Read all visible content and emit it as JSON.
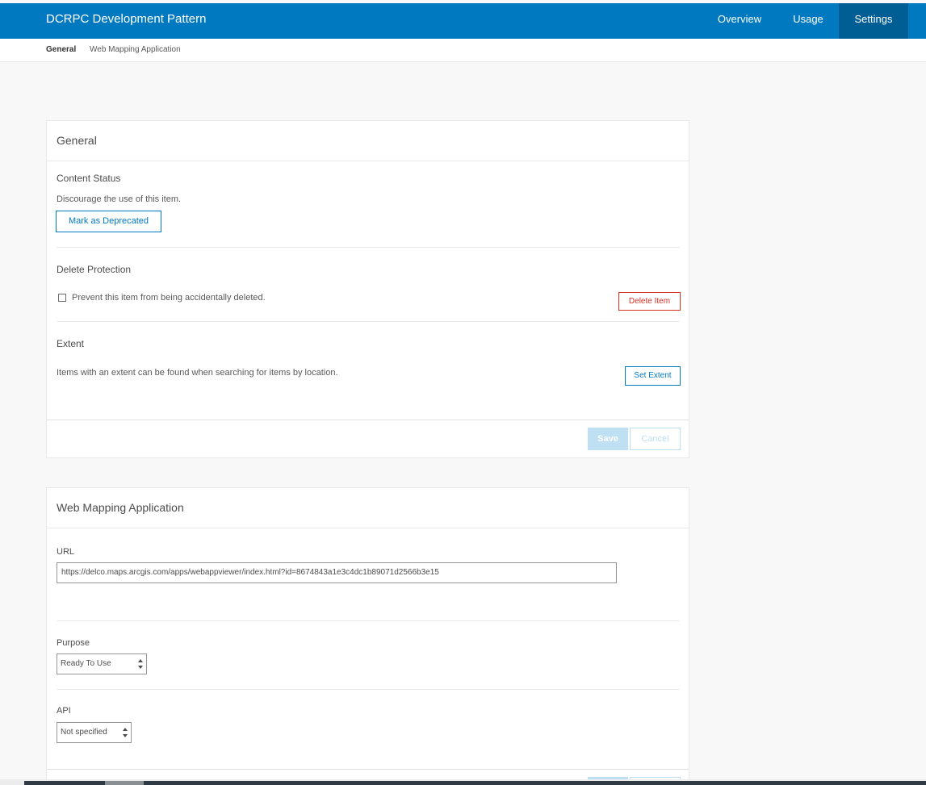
{
  "header": {
    "app_title": "DCRPC Development Pattern",
    "tabs": [
      {
        "label": "Overview"
      },
      {
        "label": "Usage"
      },
      {
        "label": "Settings",
        "active": true
      }
    ],
    "brand_color": "#0079c1"
  },
  "subnav": {
    "items": [
      {
        "label": "General",
        "active": true
      },
      {
        "label": "Web Mapping Application"
      }
    ]
  },
  "general": {
    "title": "General",
    "content_status": {
      "label": "Content Status",
      "description": "Discourage the use of this item.",
      "button": "Mark as Deprecated"
    },
    "delete_protection": {
      "label": "Delete Protection",
      "checkbox_label": "Prevent this item from being accidentally deleted.",
      "checked": false,
      "button": "Delete Item"
    },
    "extent": {
      "label": "Extent",
      "description": "Items with an extent can be found when searching for items by location.",
      "button": "Set Extent"
    },
    "save": "Save",
    "cancel": "Cancel"
  },
  "web_mapping": {
    "title": "Web Mapping Application",
    "url": {
      "label": "URL",
      "value": "https://delco.maps.arcgis.com/apps/webappviewer/index.html?id=8674843a1e3c4dc1b89071d2566b3e15"
    },
    "purpose": {
      "label": "Purpose",
      "selected": "Ready To Use"
    },
    "api": {
      "label": "API",
      "selected": "Not specified"
    }
  }
}
